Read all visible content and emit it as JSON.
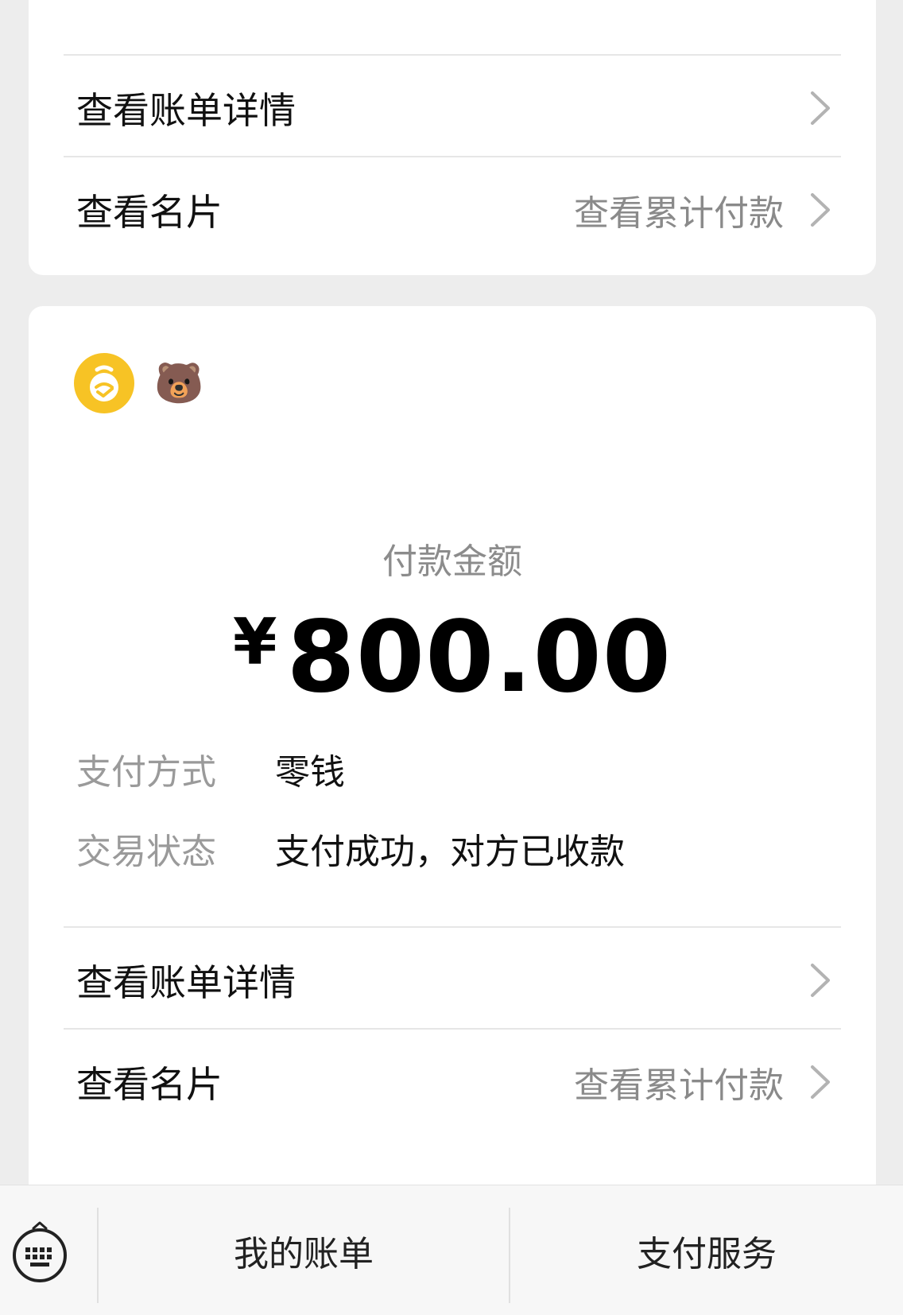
{
  "top_card": {
    "bill_detail_label": "查看账单详情",
    "card_label": "查看名片",
    "cumulative_label": "查看累计付款"
  },
  "main_card": {
    "merchant_emoji": "🐻",
    "amount_label": "付款金额",
    "currency": "¥",
    "amount": "800.00",
    "payment_method_label": "支付方式",
    "payment_method_value": "零钱",
    "status_label": "交易状态",
    "status_value": "支付成功，对方已收款",
    "bill_detail_label": "查看账单详情",
    "card_label": "查看名片",
    "cumulative_label": "查看累计付款"
  },
  "bottom_bar": {
    "my_bill": "我的账单",
    "pay_service": "支付服务"
  },
  "colors": {
    "background": "#ededed",
    "card": "#ffffff",
    "logo_yellow": "#f7c325"
  }
}
